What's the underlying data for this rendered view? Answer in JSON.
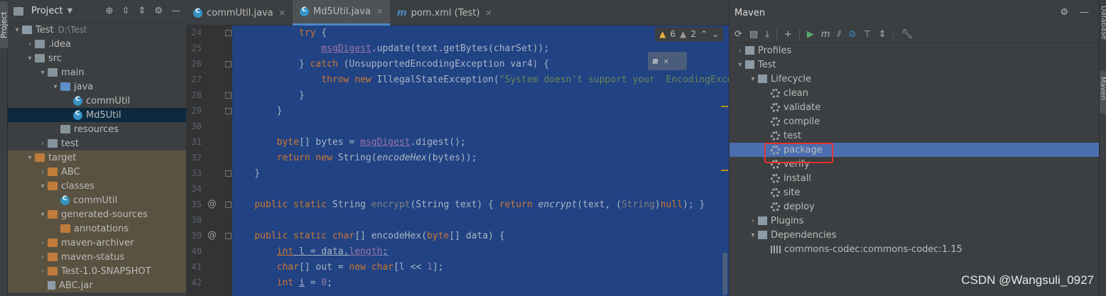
{
  "left_stripe": {
    "tab": "Project"
  },
  "project": {
    "title": "Project",
    "items": [
      {
        "label": "Test",
        "extra": "D:\\Test",
        "depth": 0,
        "arrow": "▾",
        "icon": "mod"
      },
      {
        "label": ".idea",
        "depth": 1,
        "arrow": "›",
        "icon": "folder"
      },
      {
        "label": "src",
        "depth": 1,
        "arrow": "▾",
        "icon": "folder"
      },
      {
        "label": "main",
        "depth": 2,
        "arrow": "▾",
        "icon": "folder"
      },
      {
        "label": "java",
        "depth": 3,
        "arrow": "▾",
        "icon": "blue"
      },
      {
        "label": "commUtil",
        "depth": 4,
        "arrow": "",
        "icon": "cls"
      },
      {
        "label": "Md5Util",
        "depth": 4,
        "arrow": "",
        "icon": "cls",
        "selected": true
      },
      {
        "label": "resources",
        "depth": 3,
        "arrow": "",
        "icon": "folder"
      },
      {
        "label": "test",
        "depth": 2,
        "arrow": "›",
        "icon": "folder"
      },
      {
        "label": "target",
        "depth": 1,
        "arrow": "▾",
        "icon": "orange",
        "excluded": true
      },
      {
        "label": "ABC",
        "depth": 2,
        "arrow": "›",
        "icon": "orange",
        "excluded": true
      },
      {
        "label": "classes",
        "depth": 2,
        "arrow": "▾",
        "icon": "orange",
        "excluded": true
      },
      {
        "label": "commUtil",
        "depth": 3,
        "arrow": "",
        "icon": "cls",
        "excluded": true
      },
      {
        "label": "generated-sources",
        "depth": 2,
        "arrow": "▾",
        "icon": "orange",
        "excluded": true
      },
      {
        "label": "annotations",
        "depth": 3,
        "arrow": "",
        "icon": "orange",
        "excluded": true
      },
      {
        "label": "maven-archiver",
        "depth": 2,
        "arrow": "›",
        "icon": "orange",
        "excluded": true
      },
      {
        "label": "maven-status",
        "depth": 2,
        "arrow": "›",
        "icon": "orange",
        "excluded": true
      },
      {
        "label": "Test-1.0-SNAPSHOT",
        "depth": 2,
        "arrow": "›",
        "icon": "orange",
        "excluded": true
      },
      {
        "label": "ABC.jar",
        "depth": 2,
        "arrow": "",
        "icon": "jar",
        "excluded": true
      }
    ]
  },
  "tabs": [
    {
      "label": "commUtil.java",
      "icon": "class-icon",
      "active": false
    },
    {
      "label": "Md5Util.java",
      "icon": "class-icon",
      "active": true
    },
    {
      "label": "pom.xml (Test)",
      "icon": "maven-icon",
      "active": false
    }
  ],
  "inspections": {
    "warnings": "6",
    "weak_warnings": "2"
  },
  "editor": {
    "lines": [
      {
        "n": "24",
        "html": "            <span class='kw'>try</span> {"
      },
      {
        "n": "25",
        "html": "                <span class='fld ul'>msgDigest</span>.update(text.getBytes(charSet));"
      },
      {
        "n": "26",
        "html": "            } <span class='kw'>catch</span> (UnsupportedEncodingException var4) {"
      },
      {
        "n": "27",
        "html": "                <span class='kw'>throw new</span> IllegalStateException(<span class='str'>\"System doesn't support your  EncodingException.\"</span>);"
      },
      {
        "n": "28",
        "html": "            }"
      },
      {
        "n": "29",
        "html": "        }"
      },
      {
        "n": "30",
        "html": ""
      },
      {
        "n": "31",
        "html": "        <span class='kw'>byte</span>[] bytes = <span class='fld ul'>msgDigest</span>.digest();"
      },
      {
        "n": "32",
        "html": "        <span class='kw'>return new</span> String(<span class='it'>encodeHex</span>(bytes));"
      },
      {
        "n": "33",
        "html": "    }"
      },
      {
        "n": "34",
        "html": ""
      },
      {
        "n": "35",
        "html": "    <span class='kw'>public static</span> String <span class='gray'>encrypt</span>(String text) { <span class='kw'>return</span> <span class='it'>encrypt</span>(text, (<span class='gray'>String</span>)<span class='kw'>null</span>); }"
      },
      {
        "n": "38",
        "html": ""
      },
      {
        "n": "39",
        "html": "    <span class='kw'>public static char</span>[] encodeHex(<span class='kw'>byte</span>[] data) {"
      },
      {
        "n": "40",
        "html": "        <span class='kw ul'>int</span><span class='ul'> l = data.</span><span class='fld ul'>length</span><span class='ul'>;</span>"
      },
      {
        "n": "41",
        "html": "        <span class='kw'>char</span>[] out = <span class='kw'>new char</span>[l &lt;&lt; <span class='fld'>1</span>];"
      },
      {
        "n": "42",
        "html": "        <span class='kw'>int</span> <span class='ul'>i</span> = <span class='fld'>0</span>;"
      }
    ]
  },
  "maven": {
    "title": "Maven",
    "items": [
      {
        "label": "Profiles",
        "depth": 0,
        "arrow": "›",
        "icon": "mico"
      },
      {
        "label": "Test",
        "depth": 0,
        "arrow": "▾",
        "icon": "mico"
      },
      {
        "label": "Lifecycle",
        "depth": 1,
        "arrow": "▾",
        "icon": "mico"
      },
      {
        "label": "clean",
        "depth": 2,
        "arrow": "",
        "icon": "gear"
      },
      {
        "label": "validate",
        "depth": 2,
        "arrow": "",
        "icon": "gear"
      },
      {
        "label": "compile",
        "depth": 2,
        "arrow": "",
        "icon": "gear"
      },
      {
        "label": "test",
        "depth": 2,
        "arrow": "",
        "icon": "gear"
      },
      {
        "label": "package",
        "depth": 2,
        "arrow": "",
        "icon": "gear",
        "selected": true
      },
      {
        "label": "verify",
        "depth": 2,
        "arrow": "",
        "icon": "gear"
      },
      {
        "label": "install",
        "depth": 2,
        "arrow": "",
        "icon": "gear"
      },
      {
        "label": "site",
        "depth": 2,
        "arrow": "",
        "icon": "gear"
      },
      {
        "label": "deploy",
        "depth": 2,
        "arrow": "",
        "icon": "gear"
      },
      {
        "label": "Plugins",
        "depth": 1,
        "arrow": "›",
        "icon": "mico"
      },
      {
        "label": "Dependencies",
        "depth": 1,
        "arrow": "▾",
        "icon": "mico"
      },
      {
        "label": "commons-codec:commons-codec:1.15",
        "depth": 2,
        "arrow": "",
        "icon": "bars"
      }
    ]
  },
  "right_stripe": {
    "tab1": "Database",
    "tab2": "Maven"
  },
  "watermark": "CSDN @Wangsuli_0927"
}
